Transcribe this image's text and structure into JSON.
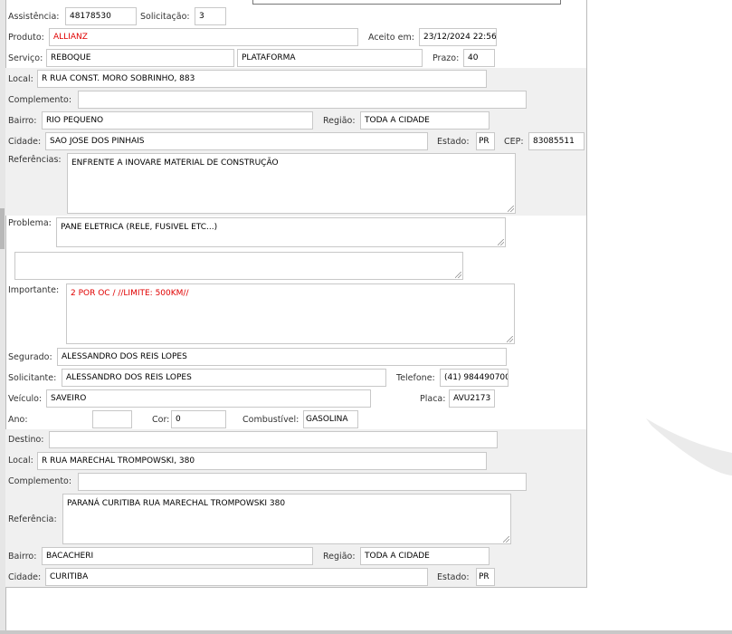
{
  "atendimento": {
    "assistencia_label": "Assistência:",
    "assistencia": "48178530",
    "solicitacao_label": "Solicitação:",
    "solicitacao": "3",
    "produto_label": "Produto:",
    "produto": "ALLIANZ",
    "aceito_label": "Aceito em:",
    "aceito": "23/12/2024 22:56",
    "servico_label": "Serviço:",
    "servico": "REBOQUE",
    "servico_tipo": "PLATAFORMA",
    "prazo_label": "Prazo:",
    "prazo": "40"
  },
  "origem": {
    "local_label": "Local:",
    "local": "R RUA CONST. MORO SOBRINHO, 883",
    "complemento_label": "Complemento:",
    "complemento": "",
    "bairro_label": "Bairro:",
    "bairro": "RIO PEQUENO",
    "regiao_label": "Região:",
    "regiao": "TODA A CIDADE",
    "cidade_label": "Cidade:",
    "cidade": "SAO JOSE DOS PINHAIS",
    "estado_label": "Estado:",
    "estado": "PR",
    "cep_label": "CEP:",
    "cep": "83085511",
    "referencias_label": "Referências:",
    "referencias": "ENFRENTE A INOVARE MATERIAL DE CONSTRUÇÃO"
  },
  "problema": {
    "problema_label": "Problema:",
    "problema": "PANE ELETRICA (RELE, FUSIVEL ETC...)",
    "observacao": "",
    "importante_label": "Importante:",
    "importante": "2 POR OC /  //LIMITE: 500KM//"
  },
  "cliente": {
    "segurado_label": "Segurado:",
    "segurado": "ALESSANDRO DOS REIS LOPES",
    "solicitante_label": "Solicitante:",
    "solicitante": "ALESSANDRO DOS REIS LOPES",
    "telefone_label": "Telefone:",
    "telefone": "(41) 984490700",
    "veiculo_label": "Veículo:",
    "veiculo": "SAVEIRO",
    "placa_label": "Placa:",
    "placa": "AVU2173",
    "ano_label": "Ano:",
    "ano": "",
    "cor_label": "Cor:",
    "cor": "0",
    "combustivel_label": "Combustível:",
    "combustivel": "GASOLINA"
  },
  "destino": {
    "destino_label": "Destino:",
    "destino": "",
    "local_label": "Local:",
    "local": "R RUA MARECHAL TROMPOWSKI, 380",
    "complemento_label": "Complemento:",
    "complemento": "",
    "referencia_label": "Referência:",
    "referencia": "PARANÁ CURITIBA RUA MARECHAL TROMPOWSKI 380",
    "bairro_label": "Bairro:",
    "bairro": "BACACHERI",
    "regiao_label": "Região:",
    "regiao": "TODA A CIDADE",
    "cidade_label": "Cidade:",
    "cidade": "CURITIBA",
    "estado_label": "Estado:",
    "estado": "PR"
  },
  "colors": {
    "highlight_text": "#e00000",
    "section_bg": "#f0f0f0"
  }
}
